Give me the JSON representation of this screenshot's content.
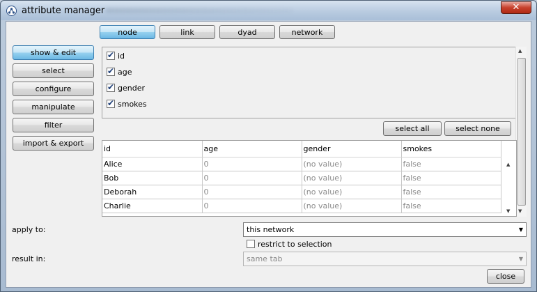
{
  "window": {
    "title": "attribute manager",
    "close_glyph": "✕"
  },
  "tabs": [
    "node",
    "link",
    "dyad",
    "network"
  ],
  "active_tab": "node",
  "sidebar": [
    "show & edit",
    "select",
    "configure",
    "manipulate",
    "filter",
    "import & export"
  ],
  "active_sidebar": "show & edit",
  "attributes": [
    {
      "label": "id",
      "checked": true
    },
    {
      "label": "age",
      "checked": true
    },
    {
      "label": "gender",
      "checked": true
    },
    {
      "label": "smokes",
      "checked": true
    }
  ],
  "buttons": {
    "select_all": "select all",
    "select_none": "select none",
    "close": "close"
  },
  "table": {
    "columns": [
      "id",
      "age",
      "gender",
      "smokes"
    ],
    "rows": [
      [
        "Alice",
        "0",
        "(no value)",
        "false"
      ],
      [
        "Bob",
        "0",
        "(no value)",
        "false"
      ],
      [
        "Deborah",
        "0",
        "(no value)",
        "false"
      ],
      [
        "Charlie",
        "0",
        "(no value)",
        "false"
      ]
    ]
  },
  "apply_to": {
    "label": "apply to:",
    "value": "this network"
  },
  "restrict": {
    "label": "restrict to selection",
    "checked": false
  },
  "result_in": {
    "label": "result in:",
    "value": "same tab"
  },
  "icons": {
    "app": "network-graph-icon",
    "check": "✔",
    "up": "▲",
    "down": "▼",
    "dropdown": "▼"
  }
}
